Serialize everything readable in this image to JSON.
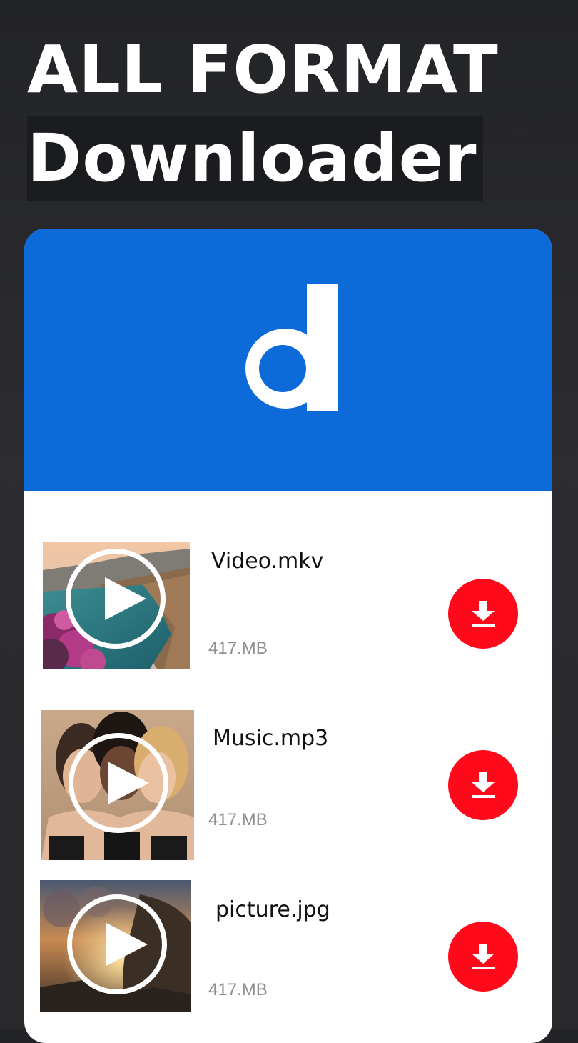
{
  "hero": {
    "line1": "ALL FORMAT",
    "line2": "Downloader"
  },
  "logo": {
    "letter": "d",
    "icon": "dailymotion-logo",
    "color": "#0d6bd9"
  },
  "colors": {
    "header": "#0d6bd9",
    "download_button": "#ff0a1b",
    "size_text": "#8f8f8f",
    "background": "#2a2a2e"
  },
  "files": [
    {
      "name": "Video.mkv",
      "size": "417.MB",
      "thumbnail": "coastal-town-photo",
      "play_icon": "play-icon",
      "download_icon": "download-icon"
    },
    {
      "name": "Music.mp3",
      "size": "417.MB",
      "thumbnail": "three-women-photo",
      "play_icon": "play-icon",
      "download_icon": "download-icon"
    },
    {
      "name": "picture.jpg",
      "size": "417.MB",
      "thumbnail": "sunset-rock-photo",
      "play_icon": "play-icon",
      "download_icon": "download-icon"
    }
  ]
}
